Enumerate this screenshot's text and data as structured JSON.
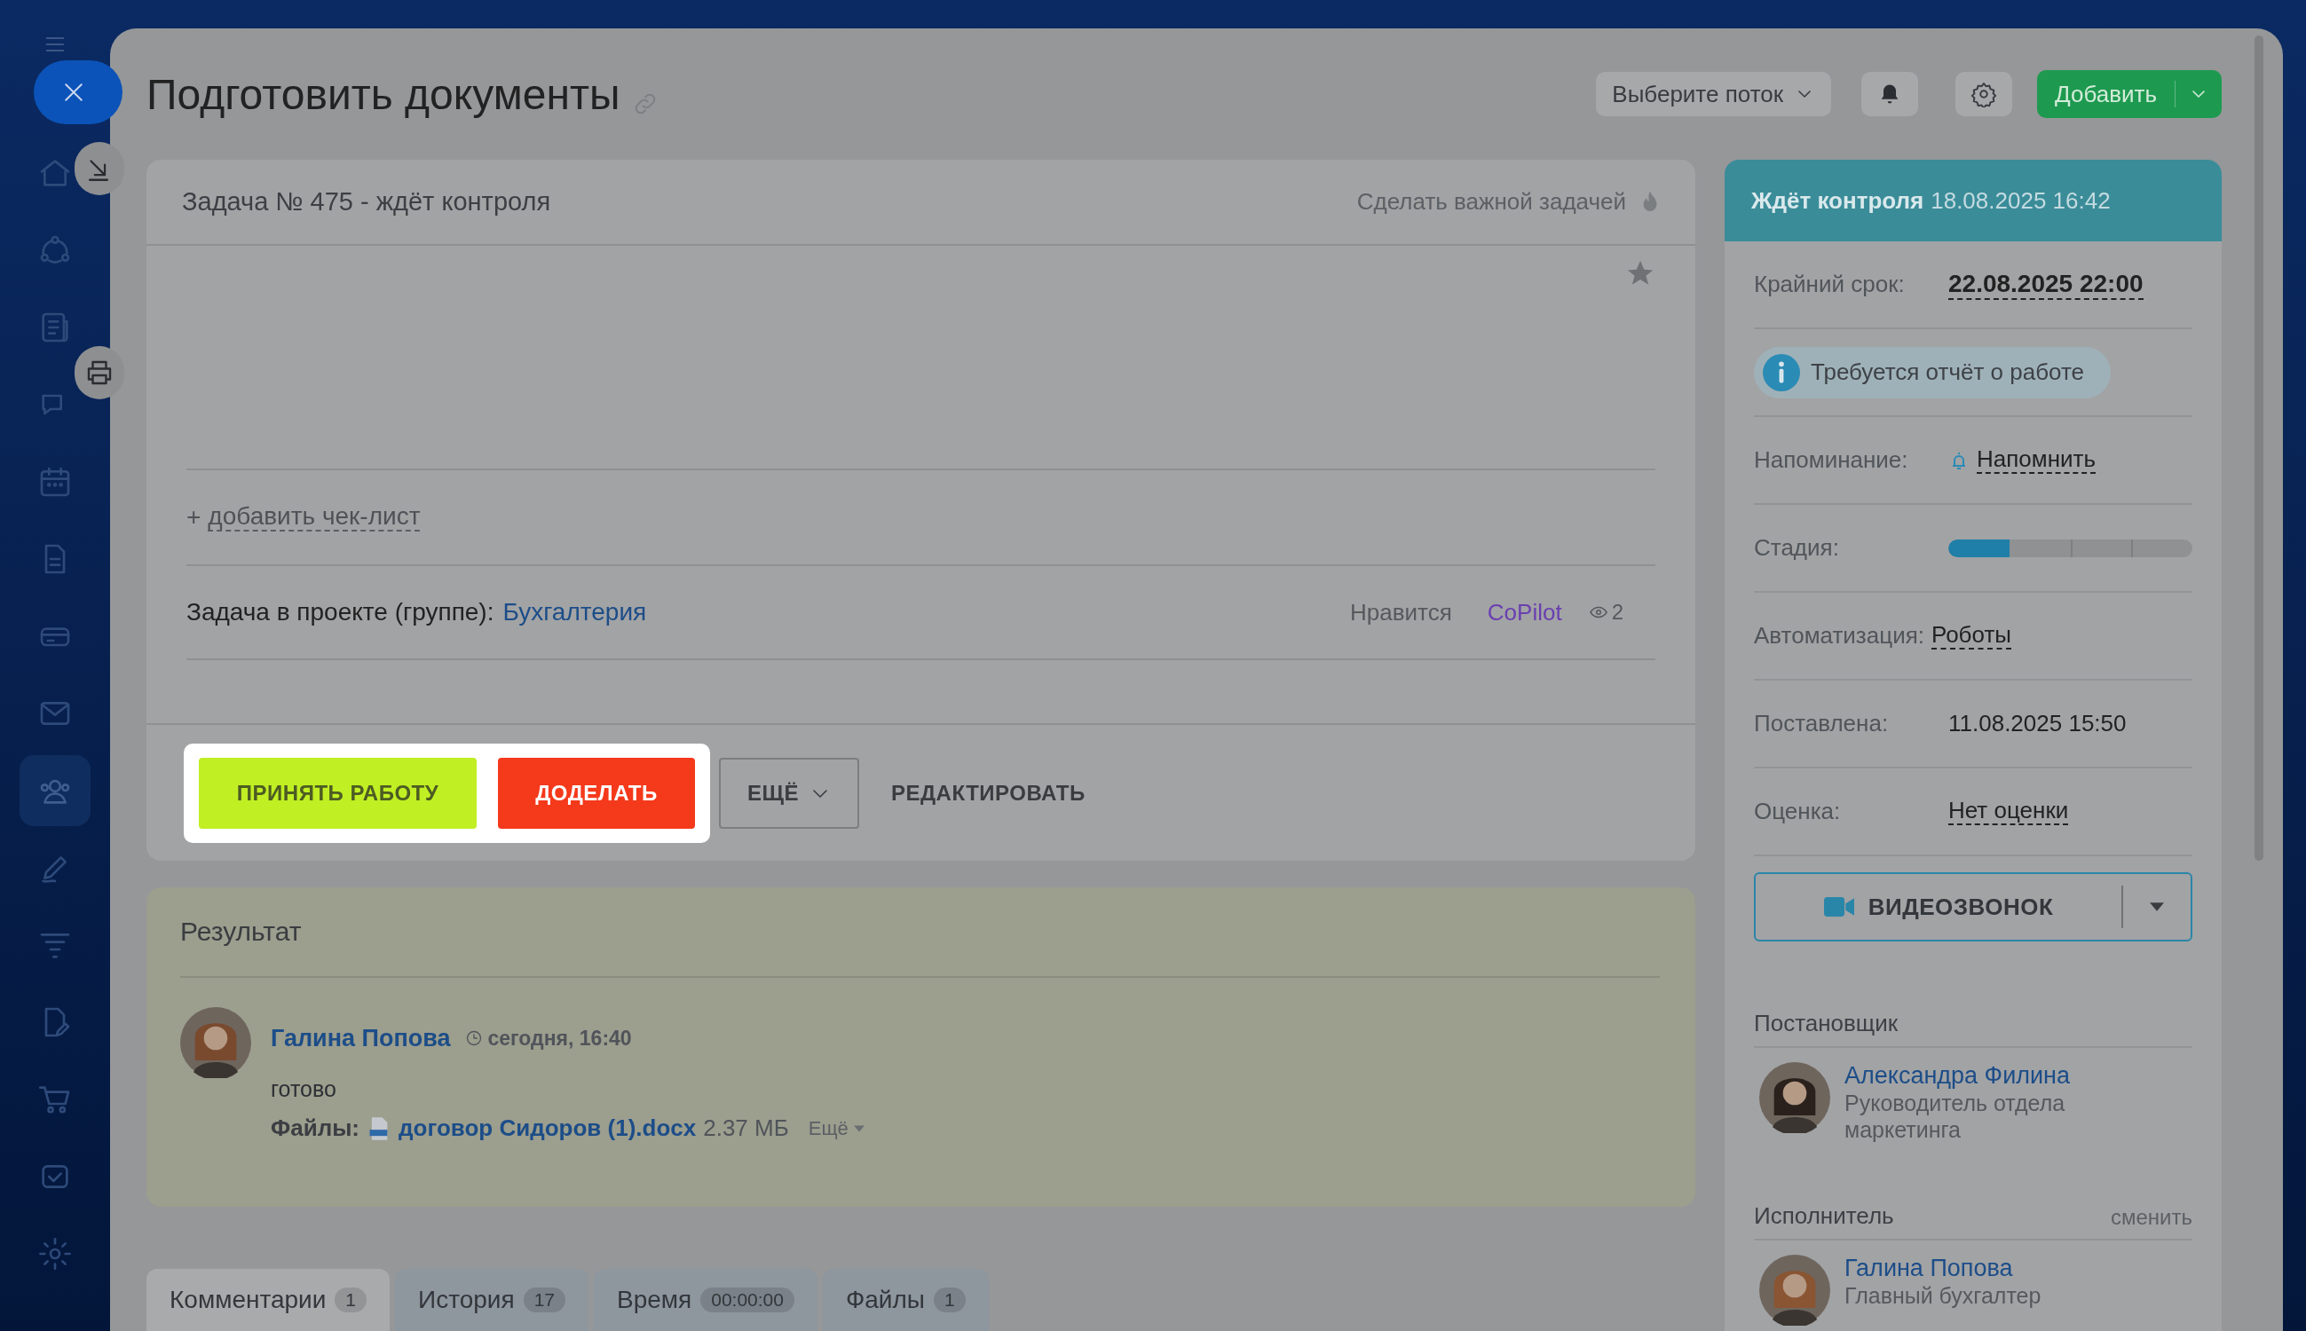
{
  "sidebar": {
    "items": [
      {
        "selected": false
      },
      {
        "selected": false
      },
      {
        "selected": false
      },
      {
        "selected": false
      },
      {
        "selected": false
      },
      {
        "selected": false
      },
      {
        "selected": false
      },
      {
        "selected": false
      },
      {
        "selected": true
      },
      {
        "selected": false
      },
      {
        "selected": false
      },
      {
        "selected": false
      },
      {
        "selected": false
      },
      {
        "selected": false
      },
      {
        "selected": false
      }
    ]
  },
  "header": {
    "title": "Подготовить документы",
    "flow_select": "Выберите поток",
    "add_button": "Добавить"
  },
  "task": {
    "heading": "Задача № 475 - ждёт контроля",
    "important_link": "Сделать важной задачей",
    "checklist_plus": "+",
    "checklist_link": "добавить чек-лист",
    "project_label": "Задача в проекте (группе):",
    "project": "Бухгалтерия",
    "like": "Нравится",
    "copilot": "CoPilot",
    "views": "2"
  },
  "actions": {
    "tour_highlight": true,
    "accept": "ПРИНЯТЬ РАБОТУ",
    "rework": "ДОДЕЛАТЬ",
    "more": "ЕЩЁ",
    "edit": "РЕДАКТИРОВАТЬ"
  },
  "result": {
    "title": "Результат",
    "author": "Галина Попова",
    "time": "сегодня, 16:40",
    "text": "готово",
    "files_label": "Файлы:",
    "file": "договор Сидоров (1).docx",
    "size": "2.37 МБ",
    "more": "Ещё"
  },
  "tabs": [
    {
      "label": "Комментарии",
      "count": "1",
      "selected": true
    },
    {
      "label": "История",
      "count": "17",
      "selected": false
    },
    {
      "label": "Время",
      "count": "00:00:00",
      "selected": false
    },
    {
      "label": "Файлы",
      "count": "1",
      "selected": false
    }
  ],
  "side": {
    "status": "Ждёт контроля",
    "status_time": "18.08.2025 16:42",
    "rows": [
      {
        "kind": "deadline",
        "label": "Крайний срок:",
        "value": "22.08.2025 22:00"
      },
      {
        "kind": "notice",
        "text": "Требуется отчёт о работе"
      },
      {
        "kind": "reminder",
        "label": "Напоминание:",
        "value": "Напомнить"
      },
      {
        "kind": "stage",
        "label": "Стадия:",
        "level": 0.25
      },
      {
        "kind": "link",
        "label": "Автоматизация:",
        "value": "Роботы"
      },
      {
        "kind": "text",
        "label": "Поставлена:",
        "value": "11.08.2025 15:50"
      },
      {
        "kind": "link",
        "label": "Оценка:",
        "value": "Нет оценки"
      }
    ],
    "video_button": "ВИДЕОЗВОНОК",
    "people": [
      {
        "title": "Постановщик",
        "name": "Александра Филина",
        "role": "Руководитель отдела маркетинга"
      },
      {
        "title": "Исполнитель",
        "action": "сменить",
        "name": "Галина Попова",
        "role": "Главный бухгалтер"
      }
    ]
  }
}
